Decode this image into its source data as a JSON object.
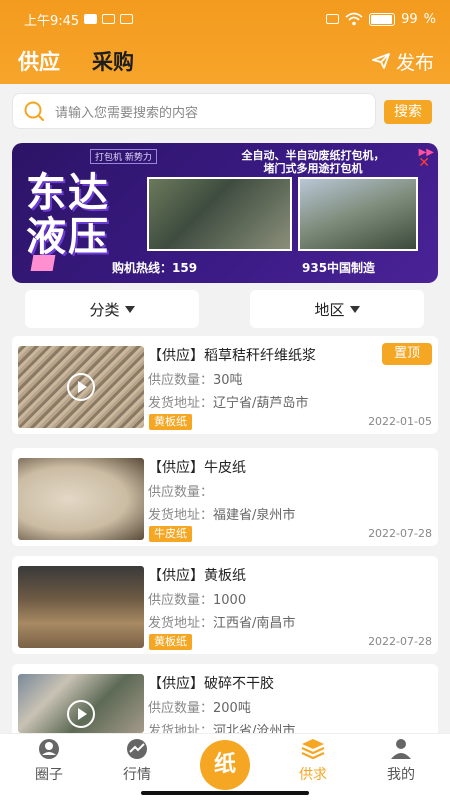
{
  "status": {
    "time": "上午9:45",
    "battery": "99"
  },
  "header": {
    "tab_supply": "供应",
    "tab_purchase": "采购",
    "publish": "发布"
  },
  "search": {
    "placeholder": "请输入您需要搜索的内容",
    "button": "搜索"
  },
  "banner": {
    "brand_line1": "东达",
    "brand_line2": "液压",
    "tag": "打包机 新势力",
    "promo_line1": "全自动、半自动废纸打包机，",
    "promo_line2": "堵门式多用途打包机",
    "hotline": "购机热线：159",
    "made": "935中国制造"
  },
  "filters": {
    "category": "分类",
    "region": "地区"
  },
  "listings": [
    {
      "title": "【供应】稻草秸秆纤维纸浆",
      "qty_label": "供应数量：",
      "qty": "30吨",
      "addr_label": "发货地址：",
      "addr": "辽宁省/葫芦岛市",
      "tag": "黄板纸",
      "date": "2022-01-05",
      "pin": "置顶"
    },
    {
      "title": "【供应】牛皮纸",
      "qty_label": "供应数量：",
      "qty": "",
      "addr_label": "发货地址：",
      "addr": "福建省/泉州市",
      "tag": "牛皮纸",
      "date": "2022-07-28"
    },
    {
      "title": "【供应】黄板纸",
      "qty_label": "供应数量：",
      "qty": "1000",
      "addr_label": "发货地址：",
      "addr": "江西省/南昌市",
      "tag": "黄板纸",
      "date": "2022-07-28"
    },
    {
      "title": "【供应】破碎不干胶",
      "qty_label": "供应数量：",
      "qty": "200吨",
      "addr_label": "发货地址：",
      "addr": "河北省/沧州市",
      "tag": "",
      "date": ""
    }
  ],
  "tabbar": {
    "circle": "圈子",
    "market": "行情",
    "center": "纸",
    "supply": "供求",
    "mine": "我的"
  },
  "colors": {
    "accent": "#f5a623",
    "header": "#f39b1e"
  },
  "icons": [
    "search-icon",
    "send-icon",
    "play-icon",
    "person-circle-icon",
    "trend-icon",
    "layers-icon",
    "user-icon",
    "wifi-icon",
    "battery-icon"
  ]
}
